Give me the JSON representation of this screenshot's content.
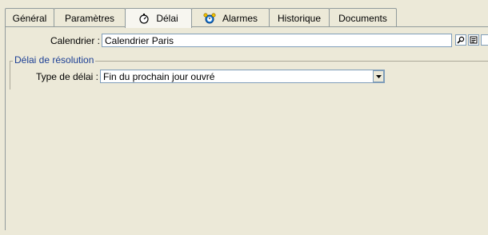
{
  "tabs": [
    {
      "label": "Général",
      "icon": "",
      "active": false
    },
    {
      "label": "Paramètres",
      "icon": "",
      "active": false
    },
    {
      "label": "Délai",
      "icon": "stopwatch-icon",
      "active": true
    },
    {
      "label": "Alarmes",
      "icon": "alarm-clock-icon",
      "active": false
    },
    {
      "label": "Historique",
      "icon": "",
      "active": false
    },
    {
      "label": "Documents",
      "icon": "",
      "active": false
    }
  ],
  "calendar": {
    "label": "Calendrier :",
    "value": "Calendrier Paris",
    "zoom_icon": "magnifier-icon",
    "details_icon": "form-icon"
  },
  "resolution_group": {
    "title": "Délai de résolution",
    "type_label": "Type de délai :",
    "type_value": "Fin du prochain jour ouvré"
  },
  "colors": {
    "window_bg": "#ece9d8",
    "group_title": "#1c3f95",
    "field_border": "#7f9db9"
  }
}
